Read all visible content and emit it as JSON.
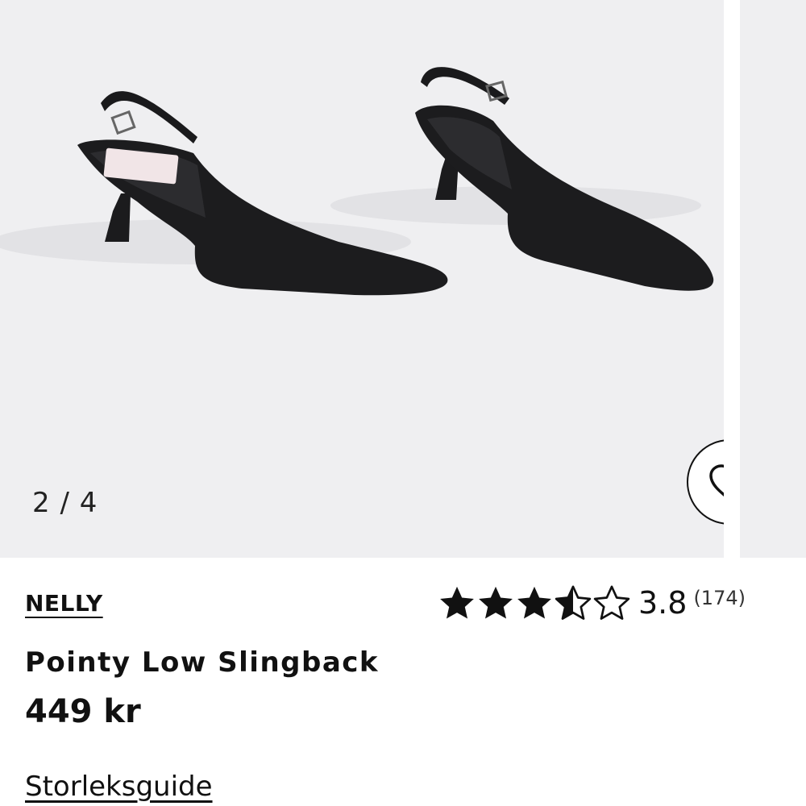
{
  "gallery": {
    "counter": "2 / 4",
    "image_alt": "Black pointy slingback kitten heels",
    "favorite_icon": "heart-icon"
  },
  "product": {
    "brand": "NELLY",
    "title": "Pointy Low Slingback",
    "price": "449 kr"
  },
  "rating": {
    "value": "3.8",
    "count": "(174)",
    "stars": 3.5,
    "max_stars": 5
  },
  "links": {
    "size_guide": "Storleksguide"
  },
  "colors": {
    "image_background": "#efeff1",
    "text": "#111111"
  }
}
